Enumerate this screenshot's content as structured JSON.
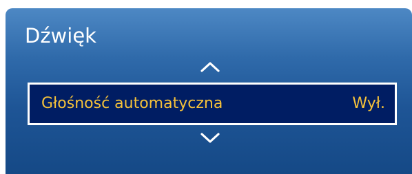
{
  "menu": {
    "title": "Dźwięk",
    "scroll_up_icon": "chevron-up-icon",
    "scroll_down_icon": "chevron-down-icon",
    "items": [
      {
        "label": "Głośność automatyczna",
        "value": "Wył."
      }
    ]
  },
  "colors": {
    "panel_top": "#4d88c4",
    "panel_bottom": "#154986",
    "selected_bg": "#001d63",
    "selected_border": "#ffffff",
    "selected_text": "#f6c23a",
    "title_text": "#ffffff"
  }
}
